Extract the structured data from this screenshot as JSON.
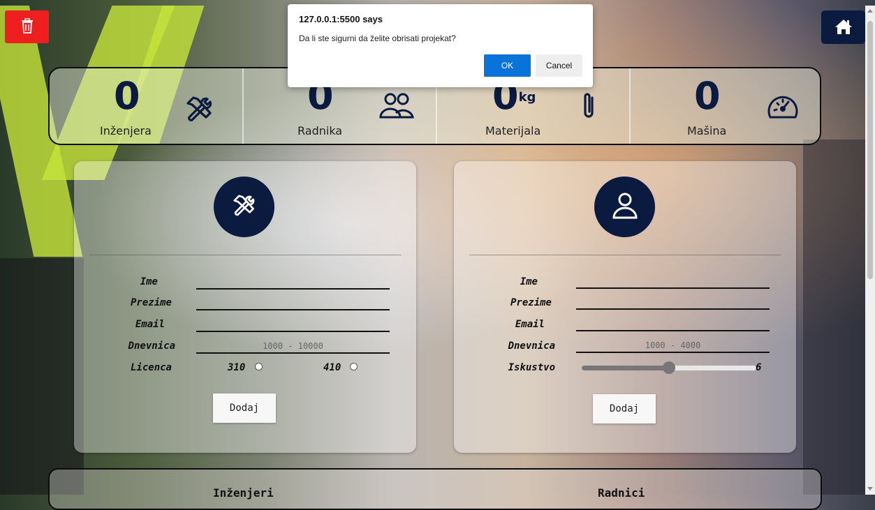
{
  "dialog": {
    "title": "127.0.0.1:5500 says",
    "message": "Da li ste sigurni da želite obrisati projekat?",
    "ok_label": "OK",
    "cancel_label": "Cancel"
  },
  "toolbar": {
    "delete_icon": "trash-icon",
    "home_icon": "home-icon",
    "delete_color": "#ef1f1f",
    "home_color": "#0b1a3f"
  },
  "stats": [
    {
      "value": "0",
      "unit": "",
      "label": "Inženjera",
      "icon": "tools-icon"
    },
    {
      "value": "0",
      "unit": "",
      "label": "Radnika",
      "icon": "users-icon"
    },
    {
      "value": "0",
      "unit": "kg",
      "label": "Materijala",
      "icon": "paperclip-icon"
    },
    {
      "value": "0",
      "unit": "",
      "label": "Mašina",
      "icon": "speedometer-icon"
    }
  ],
  "engineer_form": {
    "icon": "tools-icon",
    "labels": {
      "ime": "Ime",
      "prezime": "Prezime",
      "email": "Email",
      "dnevnica": "Dnevnica",
      "licenca": "Licenca"
    },
    "dnevnica_placeholder": "1000 - 10000",
    "license_options": [
      "310",
      "410"
    ],
    "add_label": "Dodaj"
  },
  "worker_form": {
    "icon": "user-icon",
    "labels": {
      "ime": "Ime",
      "prezime": "Prezime",
      "email": "Email",
      "dnevnica": "Dnevnica",
      "iskustvo": "Iskustvo"
    },
    "dnevnica_placeholder": "1000 - 4000",
    "iskustvo_value": "6",
    "iskustvo_fraction": 0.5,
    "add_label": "Dodaj"
  },
  "lists": {
    "engineers_title": "Inženjeri",
    "workers_title": "Radnici"
  },
  "colors": {
    "accent": "#0b1a3f",
    "dialog_ok": "#0a73d9"
  }
}
